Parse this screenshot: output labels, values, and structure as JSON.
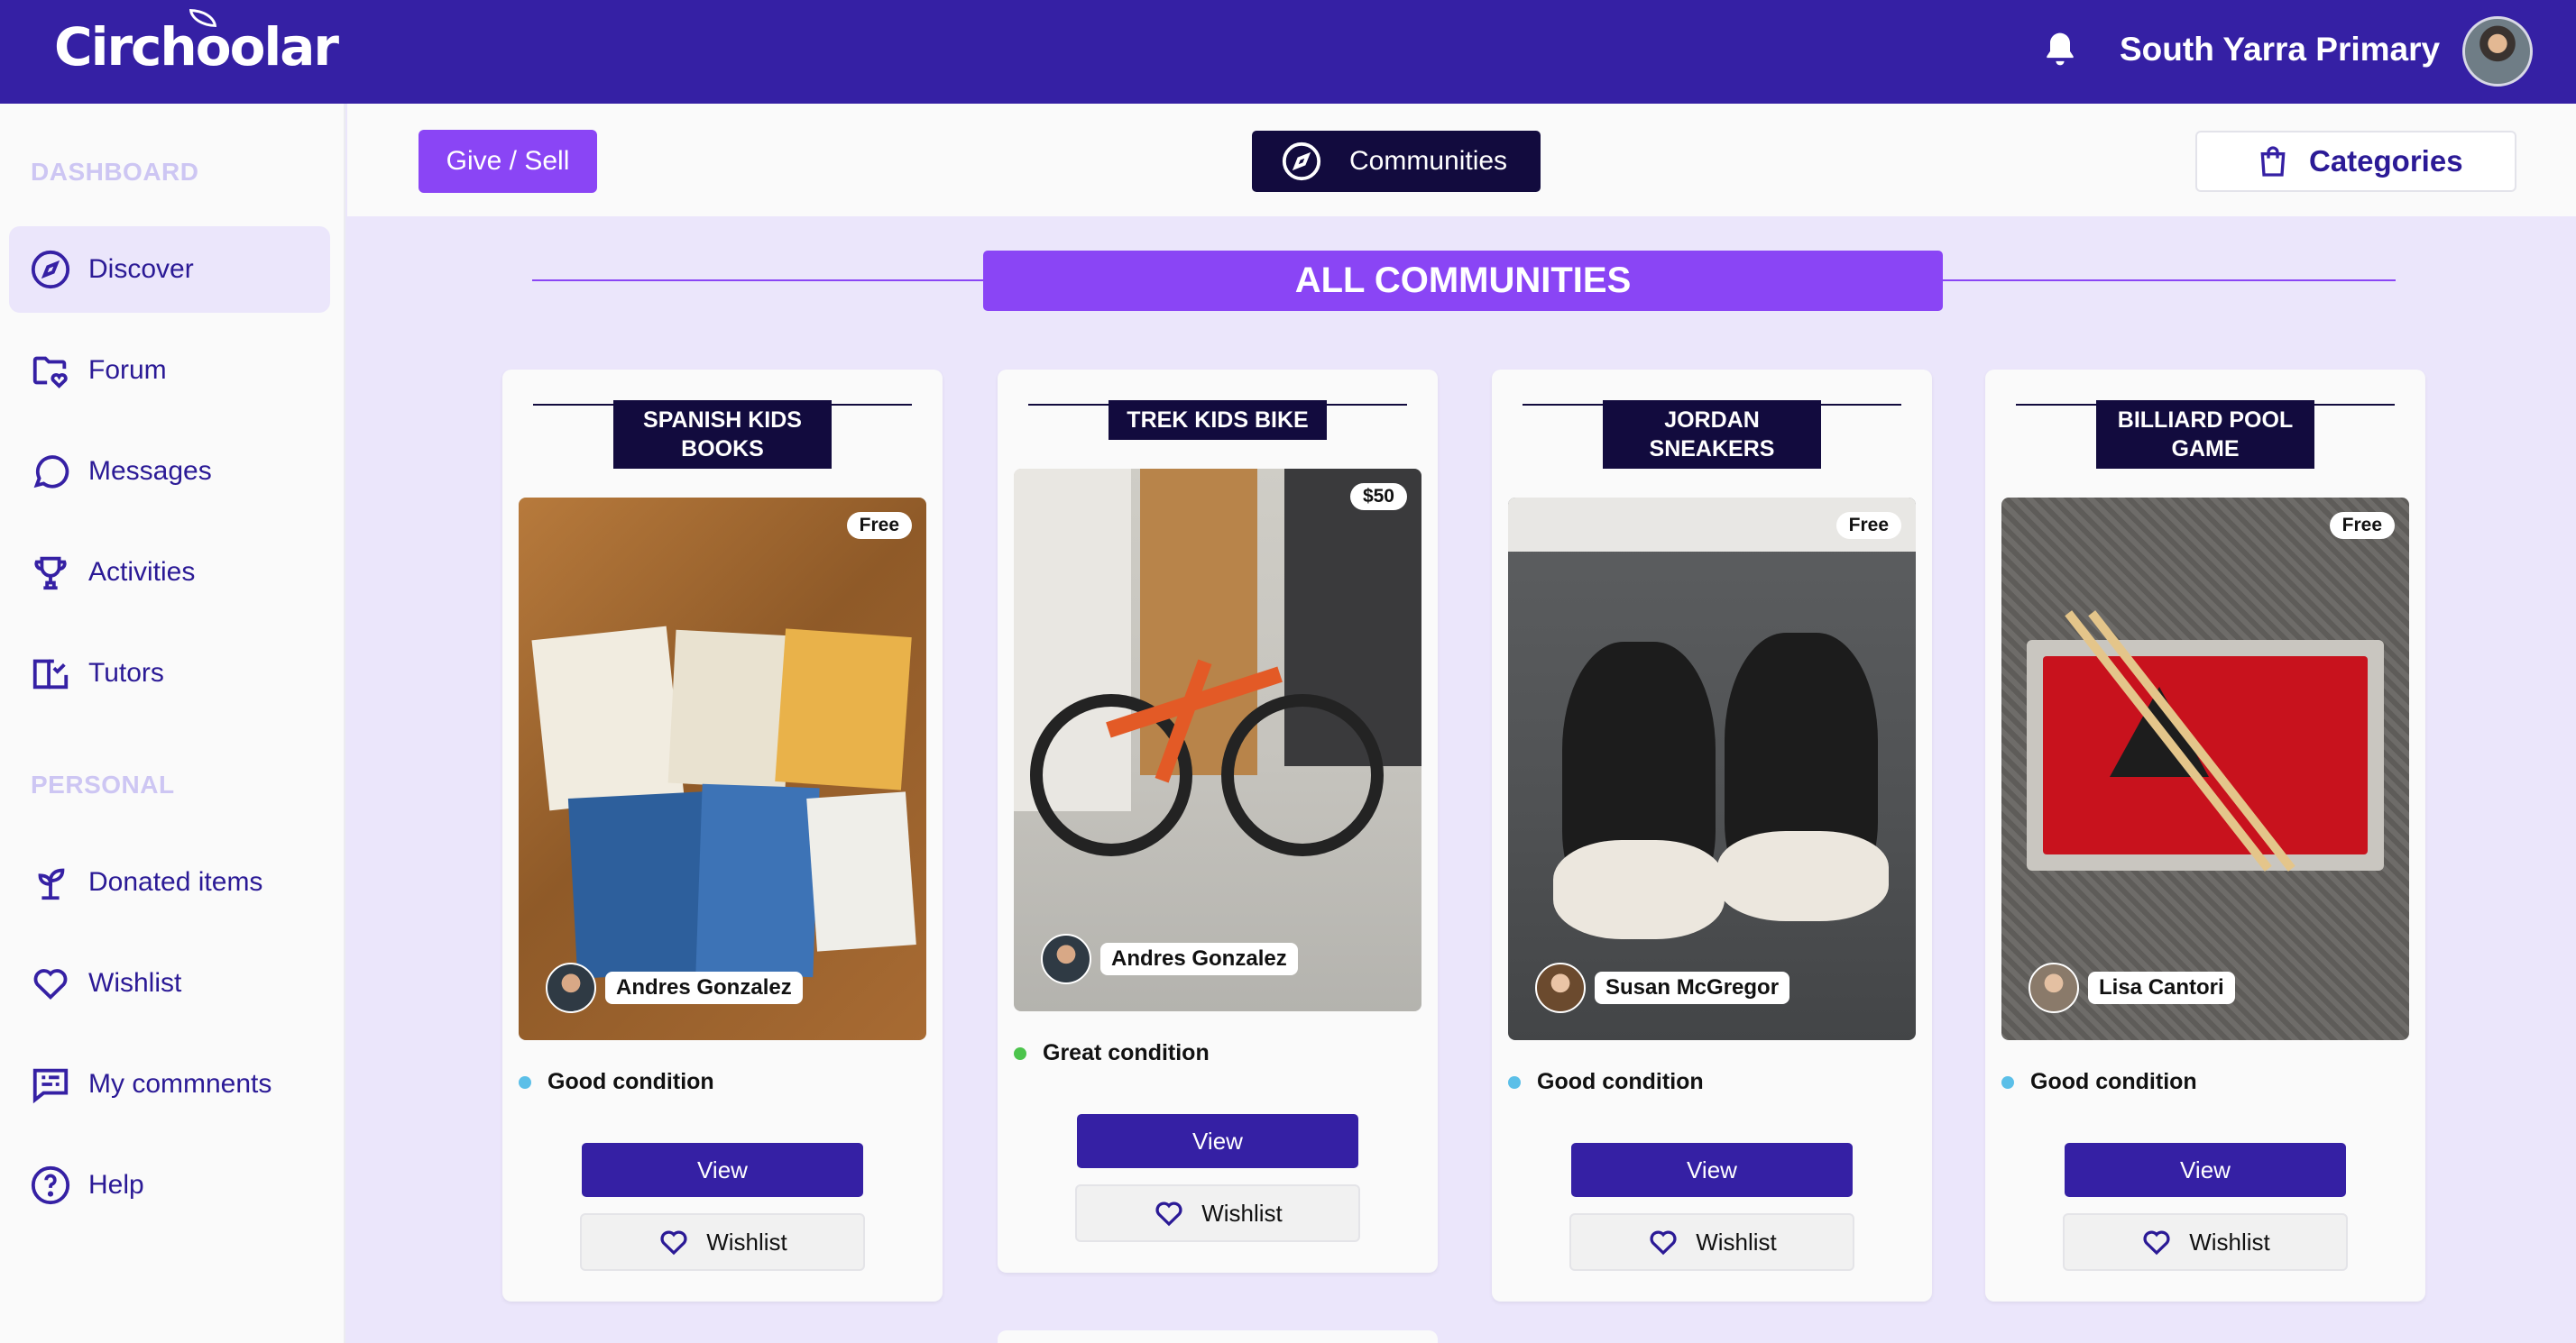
{
  "app": {
    "name": "Circhoolar",
    "school": "South Yarra Primary"
  },
  "sidebar": {
    "dashboard_label": "DASHBOARD",
    "personal_label": "PERSONAL",
    "items": [
      {
        "label": "Discover",
        "icon": "compass-icon"
      },
      {
        "label": "Forum",
        "icon": "folder-heart-icon"
      },
      {
        "label": "Messages",
        "icon": "chat-bubble-icon"
      },
      {
        "label": "Activities",
        "icon": "trophy-icon"
      },
      {
        "label": "Tutors",
        "icon": "book-check-icon"
      },
      {
        "label": "Donated items",
        "icon": "sprout-icon"
      },
      {
        "label": "Wishlist",
        "icon": "heart-icon"
      },
      {
        "label": "My commnents",
        "icon": "comment-lines-icon"
      },
      {
        "label": "Help",
        "icon": "help-circle-icon"
      }
    ]
  },
  "toolbar": {
    "give_sell": "Give / Sell",
    "communities": "Communities",
    "categories": "Categories"
  },
  "section": {
    "title": "ALL COMMUNITIES"
  },
  "cards": [
    {
      "title": "SPANISH KIDS BOOKS",
      "price": "Free",
      "owner": "Andres Gonzalez",
      "condition": "Good condition",
      "condition_color": "#5bbfe8",
      "view": "View",
      "wishlist": "Wishlist"
    },
    {
      "title": "TREK KIDS BIKE",
      "price": "$50",
      "owner": "Andres Gonzalez",
      "condition": "Great condition",
      "condition_color": "#4cc44c",
      "view": "View",
      "wishlist": "Wishlist"
    },
    {
      "title": "JORDAN SNEAKERS",
      "price": "Free",
      "owner": "Susan McGregor",
      "condition": "Good condition",
      "condition_color": "#5bbfe8",
      "view": "View",
      "wishlist": "Wishlist"
    },
    {
      "title": "BILLIARD POOL GAME",
      "price": "Free",
      "owner": "Lisa Cantori",
      "condition": "Good condition",
      "condition_color": "#5bbfe8",
      "view": "View",
      "wishlist": "Wishlist"
    }
  ],
  "colors": {
    "brand": "#3520a4",
    "accent": "#8a45f5",
    "dark": "#120b3e"
  }
}
